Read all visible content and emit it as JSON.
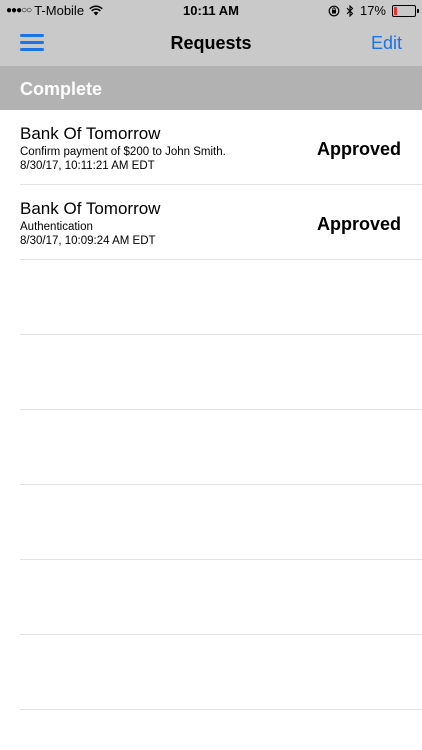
{
  "status_bar": {
    "signal": "●●●○○",
    "carrier": "T-Mobile",
    "time": "10:11 AM",
    "battery": "17%",
    "battery_level": 0.17,
    "battery_color": "#e33333",
    "icons": [
      "wifi-icon",
      "rotation-lock-icon",
      "bluetooth-icon",
      "battery-icon"
    ]
  },
  "nav": {
    "title": "Requests",
    "edit_label": "Edit",
    "accent_color": "#1a73e8"
  },
  "section": {
    "title": "Complete"
  },
  "requests": [
    {
      "org": "Bank Of Tomorrow",
      "description": "Confirm payment of $200 to John Smith.",
      "timestamp": "8/30/17, 10:11:21 AM EDT",
      "status": "Approved"
    },
    {
      "org": "Bank Of Tomorrow",
      "description": "Authentication",
      "timestamp": "8/30/17, 10:09:24 AM EDT",
      "status": "Approved"
    }
  ]
}
